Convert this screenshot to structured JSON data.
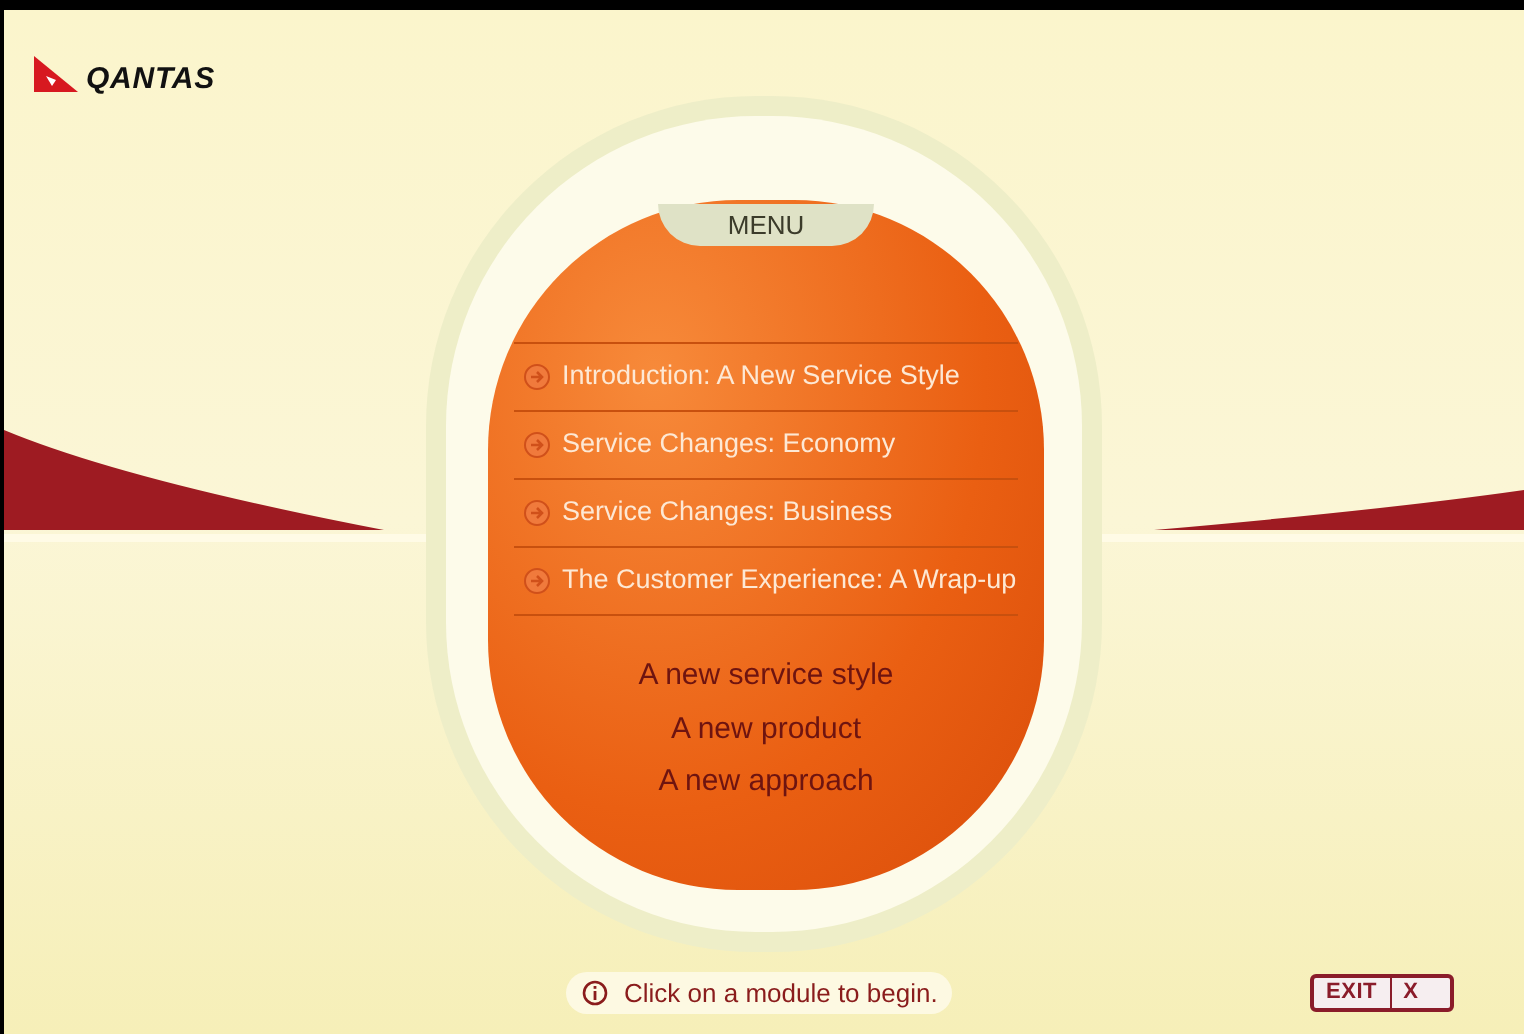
{
  "logo": {
    "text": "QANTAS"
  },
  "menu": {
    "title": "MENU",
    "items": [
      {
        "label": "Introduction: A New Service Style"
      },
      {
        "label": "Service Changes: Economy"
      },
      {
        "label": "Service Changes: Business"
      },
      {
        "label": "The Customer Experience: A Wrap-up"
      }
    ],
    "taglines": [
      "A new service style",
      "A new product",
      "A new approach"
    ]
  },
  "hint": {
    "text": "Click on a module to begin."
  },
  "exit_button": {
    "label": "EXIT",
    "close": "X"
  }
}
